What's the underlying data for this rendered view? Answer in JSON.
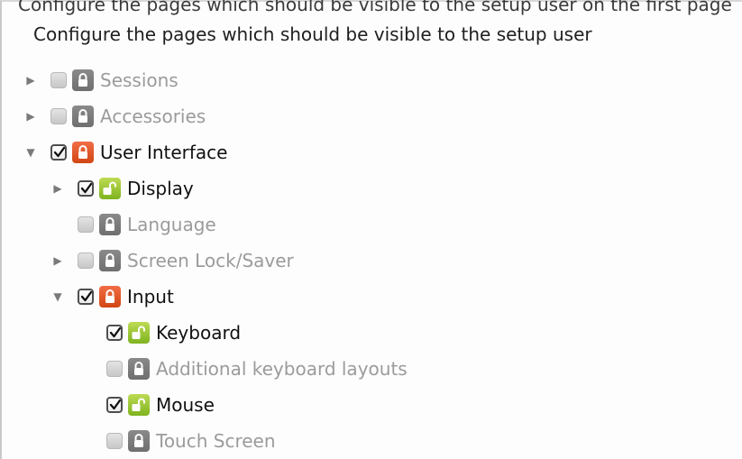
{
  "header": {
    "cut_text": "Configure the pages which should be visible to the setup user on the first page",
    "title": "Configure the pages which should be visible to the setup user"
  },
  "tree": [
    {
      "id": "sessions",
      "label": "Sessions",
      "level": 0,
      "expander": "collapsed",
      "checked": false,
      "lock": "locked",
      "active": false
    },
    {
      "id": "accessories",
      "label": "Accessories",
      "level": 0,
      "expander": "collapsed",
      "checked": false,
      "lock": "locked",
      "active": false
    },
    {
      "id": "user-interface",
      "label": "User Interface",
      "level": 0,
      "expander": "expanded",
      "checked": true,
      "lock": "locked-highlight",
      "active": true
    },
    {
      "id": "display",
      "label": "Display",
      "level": 1,
      "expander": "collapsed",
      "checked": true,
      "lock": "unlocked",
      "active": true
    },
    {
      "id": "language",
      "label": "Language",
      "level": 1,
      "expander": "none",
      "checked": false,
      "lock": "locked",
      "active": false
    },
    {
      "id": "screen-lock-saver",
      "label": "Screen Lock/Saver",
      "level": 1,
      "expander": "collapsed",
      "checked": false,
      "lock": "locked",
      "active": false
    },
    {
      "id": "input",
      "label": "Input",
      "level": 1,
      "expander": "expanded",
      "checked": true,
      "lock": "locked-highlight",
      "active": true
    },
    {
      "id": "keyboard",
      "label": "Keyboard",
      "level": 2,
      "expander": "none",
      "checked": true,
      "lock": "unlocked",
      "active": true
    },
    {
      "id": "additional-keyboard-layouts",
      "label": "Additional keyboard layouts",
      "level": 2,
      "expander": "none",
      "checked": false,
      "lock": "locked",
      "active": false
    },
    {
      "id": "mouse",
      "label": "Mouse",
      "level": 2,
      "expander": "none",
      "checked": true,
      "lock": "unlocked",
      "active": true
    },
    {
      "id": "touch-screen",
      "label": "Touch Screen",
      "level": 2,
      "expander": "none",
      "checked": false,
      "lock": "locked",
      "active": false
    }
  ]
}
